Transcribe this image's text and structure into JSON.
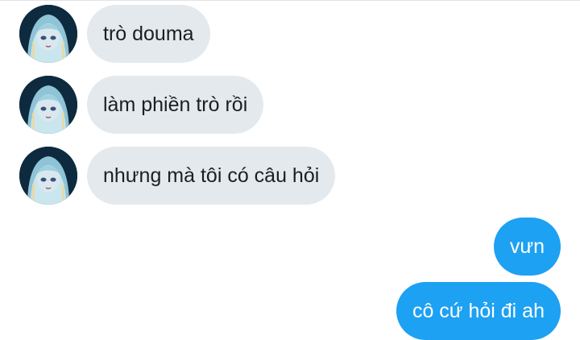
{
  "thread": {
    "messages": [
      {
        "sender": "other",
        "text": "trò douma"
      },
      {
        "sender": "other",
        "text": "làm phiền trò rồi"
      },
      {
        "sender": "other",
        "text": "nhưng mà tôi có câu hỏi"
      },
      {
        "sender": "me",
        "text": "vưn"
      },
      {
        "sender": "me",
        "text": "cô cứ hỏi đi ah"
      }
    ]
  },
  "colors": {
    "received_bubble": "#e4e9ee",
    "sent_bubble": "#1da1f2",
    "received_text": "#1b1f23",
    "sent_text": "#ffffff"
  },
  "icons": {
    "avatar": "anime-character-avatar-icon"
  }
}
